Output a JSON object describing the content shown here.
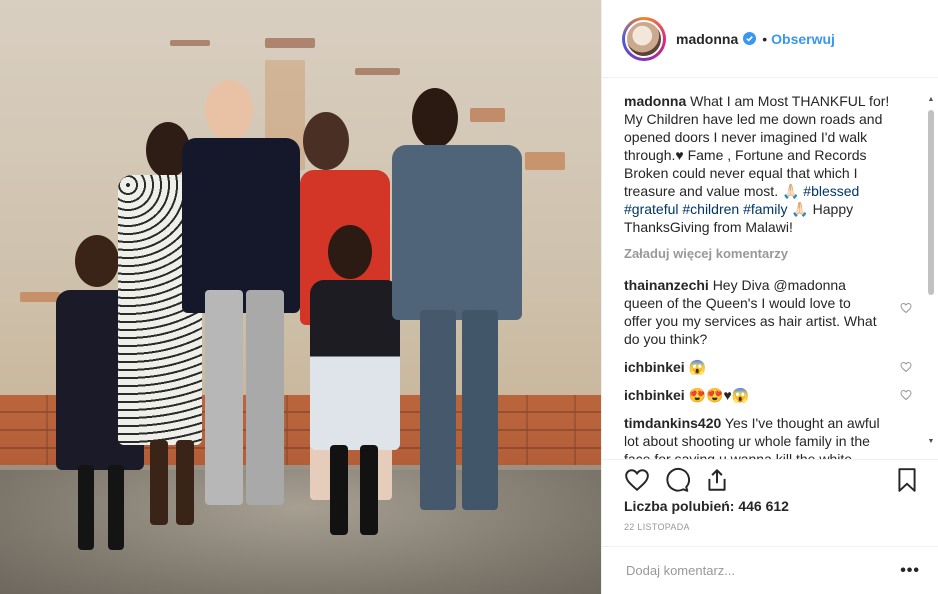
{
  "photo": {
    "alt_icon": "family-photo"
  },
  "header": {
    "username": "madonna",
    "separator": "•",
    "follow_label": "Obserwuj"
  },
  "caption": {
    "author": "madonna",
    "text_main": "What I am Most THANKFUL for! My Children have led me down roads and opened doors I never imagined I'd walk through.♥ Fame , Fortune and Records Broken could never equal that which I treasure and value most. 🙏🏻 ",
    "tag1": "#blessed",
    "tag2": "#grateful",
    "tag3": "#children",
    "tag4": "#family",
    "text_tail": " 🙏🏻 Happy ThanksGiving from Malawi!"
  },
  "load_more": "Załaduj więcej komentarzy",
  "comments": [
    {
      "user": "thainanzechi",
      "text": "Hey Diva @madonna queen of the Queen's I would love to offer you my services as hair artist. What do you think?"
    },
    {
      "user": "ichbinkei",
      "text": "😱"
    },
    {
      "user": "ichbinkei",
      "text": "😍😍♥😱"
    },
    {
      "user": "timdankins420",
      "text": "Yes I've thought an awful lot about shooting ur whole family in the face for saying u wanna kill the white house for the remark"
    }
  ],
  "likes": "Liczba polubień: 446 612",
  "date": "22 LISTOPADA",
  "add_comment": {
    "placeholder": "Dodaj komentarz...",
    "more": "•••"
  },
  "colors": {
    "accent": "#3897f0",
    "hashtag": "#003569",
    "muted": "#999999"
  }
}
